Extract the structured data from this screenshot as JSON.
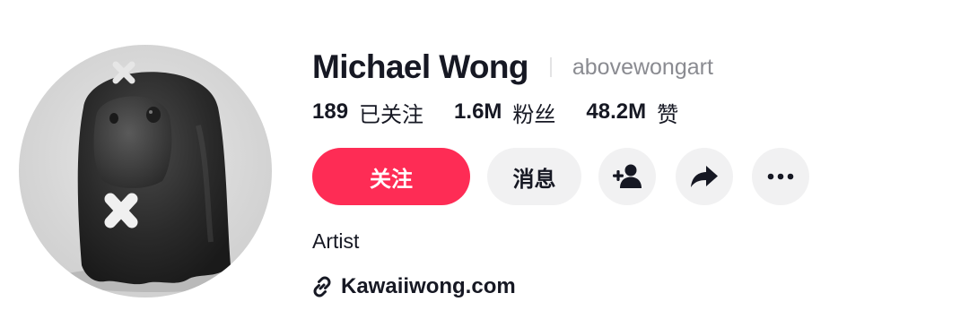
{
  "profile": {
    "display_name": "Michael Wong",
    "username": "abovewongart",
    "bio": "Artist",
    "link": "Kawaiiwong.com"
  },
  "stats": {
    "following": {
      "value": "189",
      "label": "已关注"
    },
    "followers": {
      "value": "1.6M",
      "label": "粉丝"
    },
    "likes": {
      "value": "48.2M",
      "label": "赞"
    }
  },
  "actions": {
    "follow_label": "关注",
    "message_label": "消息",
    "add_friend_icon": "add-friend-icon",
    "share_icon": "share-icon",
    "more_icon": "more-icon"
  },
  "colors": {
    "accent": "#fe2c55",
    "button_bg": "#f1f1f2",
    "text_primary": "#161823",
    "text_secondary": "#8a8b91"
  }
}
